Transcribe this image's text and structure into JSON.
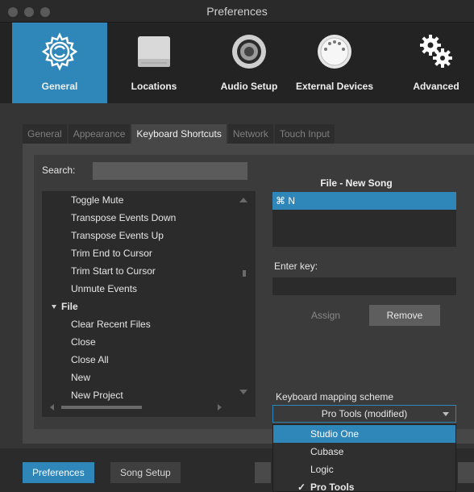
{
  "window": {
    "title": "Preferences"
  },
  "toolbar": {
    "items": [
      {
        "label": "General",
        "icon": "gear-icon",
        "active": true
      },
      {
        "label": "Locations",
        "icon": "drive-icon",
        "active": false
      },
      {
        "label": "Audio Setup",
        "icon": "speaker-icon",
        "active": false
      },
      {
        "label": "External Devices",
        "icon": "midi-plug-icon",
        "active": false
      },
      {
        "label": "Advanced",
        "icon": "gears-icon",
        "active": false
      }
    ]
  },
  "subtabs": [
    {
      "label": "General",
      "active": false
    },
    {
      "label": "Appearance",
      "active": false
    },
    {
      "label": "Keyboard Shortcuts",
      "active": true
    },
    {
      "label": "Network",
      "active": false
    },
    {
      "label": "Touch Input",
      "active": false
    }
  ],
  "search": {
    "label": "Search:",
    "value": ""
  },
  "commands": [
    {
      "label": "Toggle Mute",
      "type": "child"
    },
    {
      "label": "Transpose Events Down",
      "type": "child"
    },
    {
      "label": "Transpose Events Up",
      "type": "child"
    },
    {
      "label": "Trim End to Cursor",
      "type": "child"
    },
    {
      "label": "Trim Start to Cursor",
      "type": "child"
    },
    {
      "label": "Unmute Events",
      "type": "child"
    },
    {
      "label": "File",
      "type": "category"
    },
    {
      "label": "Clear Recent Files",
      "type": "child"
    },
    {
      "label": "Close",
      "type": "child"
    },
    {
      "label": "Close All",
      "type": "child"
    },
    {
      "label": "New",
      "type": "child"
    },
    {
      "label": "New Project",
      "type": "child"
    }
  ],
  "shortcut": {
    "title": "File - New Song",
    "keys": [
      "⌘ N"
    ],
    "enter_key_label": "Enter key:",
    "enter_key_value": "",
    "assign_label": "Assign",
    "remove_label": "Remove"
  },
  "scheme": {
    "label": "Keyboard mapping scheme",
    "selected": "Pro Tools (modified)",
    "options": [
      {
        "label": "Studio One",
        "highlighted": true,
        "checked": false
      },
      {
        "label": "Cubase",
        "highlighted": false,
        "checked": false
      },
      {
        "label": "Logic",
        "highlighted": false,
        "checked": false
      },
      {
        "label": "Pro Tools",
        "highlighted": false,
        "checked": true
      }
    ]
  },
  "bottombar": {
    "preferences_label": "Preferences",
    "song_setup_label": "Song Setup"
  },
  "colors": {
    "accent": "#2f86b8",
    "background": "#353535",
    "panel": "#3b3b3b"
  }
}
